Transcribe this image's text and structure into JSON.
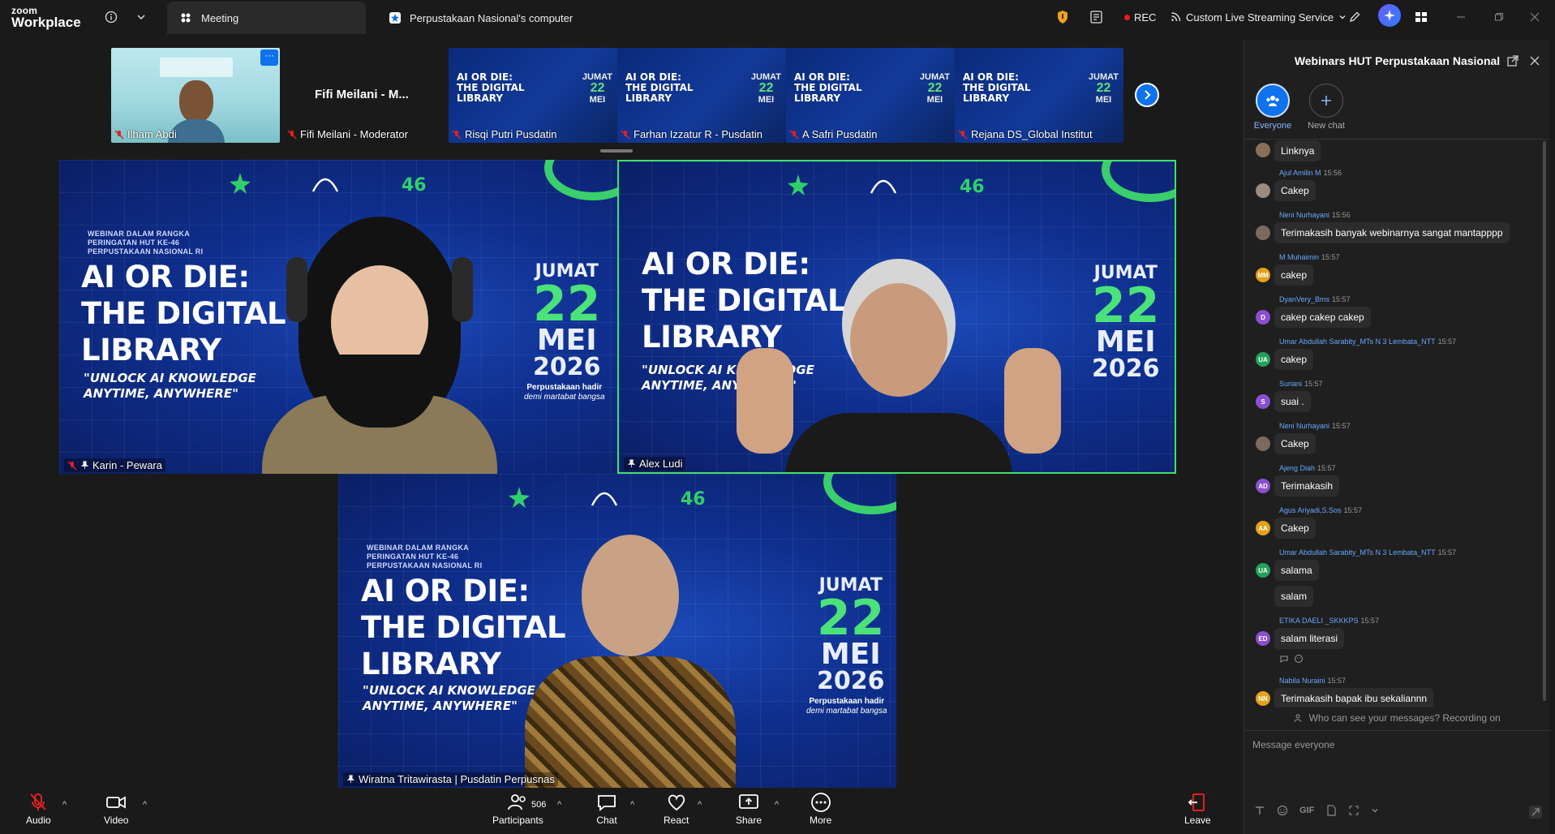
{
  "app": {
    "brand_line1": "zoom",
    "brand_line2": "Workplace"
  },
  "tabs": [
    {
      "label": "Meeting"
    },
    {
      "label": "Perpustakaan Nasional's computer sou"
    }
  ],
  "topright": {
    "rec": "REC",
    "streaming": "Custom Live Streaming Service"
  },
  "thumbnails": [
    {
      "name": "Ilham Abdi"
    },
    {
      "name": "Fifi Meilani - Moderator",
      "display": "Fifi Meilani - M..."
    },
    {
      "name": "Risqi Putri Pusdatin"
    },
    {
      "name": "Farhan Izzatur R - Pusdatin"
    },
    {
      "name": "A Safri Pusdatin"
    },
    {
      "name": "Rejana DS_Global Institut"
    }
  ],
  "banner": {
    "small1": "WEBINAR DALAM RANGKA",
    "small2": "PERINGATAN HUT KE-46",
    "small3": "PERPUSTAKAAN NASIONAL RI",
    "line1": "AI OR DIE:",
    "line2": "THE DIGITAL",
    "line3": "LIBRARY",
    "sub1": "\"UNLOCK AI KNOWLEDGE",
    "sub2": "ANYTIME, ANYWHERE\"",
    "day": "JUMAT",
    "num": "22",
    "month": "MEI",
    "year": "2026",
    "tag1": "Perpustakaan hadir",
    "tag2": "demi martabat bangsa"
  },
  "tiles": [
    {
      "name": "Karin - Pewara"
    },
    {
      "name": "Alex Ludi"
    },
    {
      "name": "Wiratna Tritawirasta | Pusdatin Perpusnas"
    }
  ],
  "toolbar": {
    "audio": "Audio",
    "video": "Video",
    "participants": "Participants",
    "participants_count": "506",
    "chat": "Chat",
    "react": "React",
    "share": "Share",
    "more": "More",
    "leave": "Leave"
  },
  "chat": {
    "title": "Webinars HUT Perpustakaan Nasional",
    "tab_everyone": "Everyone",
    "tab_new": "New chat",
    "notice": "Who can see your messages? Recording on",
    "placeholder": "Message everyone",
    "gif": "GIF",
    "messages": [
      {
        "sender": "",
        "time": "",
        "text": "Linknya",
        "initials": "",
        "color": "#8a6e5a"
      },
      {
        "sender": "Ajul Amilin M",
        "time": "15:56",
        "text": "Cakep",
        "initials": "",
        "color": "#9a8a80"
      },
      {
        "sender": "Neni Nurhayani",
        "time": "15:56",
        "text": "Terimakasih banyak webinarnya sangat mantapppp",
        "initials": "",
        "color": "#7a6a60"
      },
      {
        "sender": "M Muhaimin",
        "time": "15:57",
        "text": "cakep",
        "initials": "MM",
        "color": "#e3a21a"
      },
      {
        "sender": "DyanVery_Bms",
        "time": "15:57",
        "text": "cakep cakep cakep",
        "initials": "D",
        "color": "#8a4fd0"
      },
      {
        "sender": "Umar Abdullah Sarabity_MTs N 3 Lembata_NTT",
        "time": "15:57",
        "text": "cakep",
        "initials": "UA",
        "color": "#23a15a"
      },
      {
        "sender": "Suriani",
        "time": "15:57",
        "text": "suai .",
        "initials": "S",
        "color": "#8a4fd0"
      },
      {
        "sender": "Neni Nurhayani",
        "time": "15:57",
        "text": "Cakep",
        "initials": "",
        "color": "#7a6a60"
      },
      {
        "sender": "Ajeng Diah",
        "time": "15:57",
        "text": "Terimakasih",
        "initials": "AD",
        "color": "#8a4fd0"
      },
      {
        "sender": "Agus Ariyadi,S.Sos",
        "time": "15:57",
        "text": "Cakep",
        "initials": "AA",
        "color": "#e3a21a"
      },
      {
        "sender": "Umar Abdullah Sarabity_MTs N 3 Lembata_NTT",
        "time": "15:57",
        "text": "salama",
        "initials": "UA",
        "color": "#23a15a"
      },
      {
        "sender": "",
        "time": "",
        "text": "salam",
        "initials": "",
        "color": ""
      },
      {
        "sender": "ETIKA DAELI _SKKKPS",
        "time": "15:57",
        "text": "salam literasi",
        "initials": "ED",
        "color": "#8a4fd0"
      },
      {
        "sender": "Nabila Nuraini",
        "time": "15:57",
        "text": "Terimakasih bapak ibu sekaliannn",
        "initials": "NN",
        "color": "#e3a21a"
      }
    ]
  }
}
